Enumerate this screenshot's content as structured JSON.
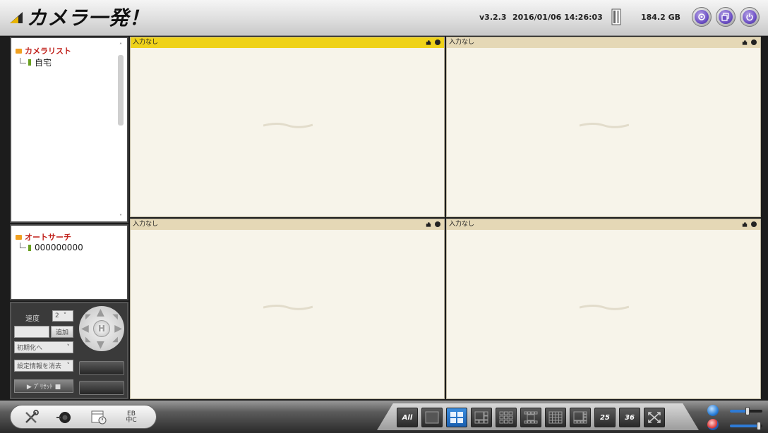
{
  "app": {
    "logo_text": "カメラ一発！"
  },
  "header": {
    "version": "v3.2.3",
    "datetime": "2016/01/06 14:26:03",
    "storage": "184.2 GB",
    "buttons": [
      {
        "icon": "settings-circle-icon"
      },
      {
        "icon": "restore-window-icon"
      },
      {
        "icon": "power-icon"
      }
    ]
  },
  "camera_list": {
    "title": "カメラリスト",
    "items": [
      {
        "label": "自宅"
      }
    ]
  },
  "auto_search": {
    "title": "オートサーチ",
    "items": [
      {
        "label": "000000000"
      }
    ]
  },
  "controls": {
    "speed_label": "速度",
    "speed_value": "2",
    "add_button": "追加",
    "preset_select": "初期化へ",
    "settings_select": "設定情報を消去",
    "bottom_button": "▶ ﾌﾟﾘｾｯﾄ ■"
  },
  "tiles": [
    {
      "label": "入力なし",
      "active": true
    },
    {
      "label": "入力なし",
      "active": false
    },
    {
      "label": "入力なし",
      "active": false
    },
    {
      "label": "入力なし",
      "active": false
    }
  ],
  "bottom_tools": [
    {
      "icon": "tools-icon"
    },
    {
      "icon": "camera-icon"
    },
    {
      "icon": "schedule-icon"
    },
    {
      "icon": "language-icon",
      "text": "EB 中C"
    }
  ],
  "layouts": [
    {
      "label": "All",
      "selected": false
    },
    {
      "label": "1",
      "selected": false
    },
    {
      "label": "4",
      "selected": true
    },
    {
      "label": "6",
      "selected": false
    },
    {
      "label": "9",
      "selected": false
    },
    {
      "label": "13",
      "selected": false
    },
    {
      "label": "16",
      "selected": false
    },
    {
      "label": "8",
      "selected": false
    },
    {
      "label": "25",
      "selected": false
    },
    {
      "label": "36",
      "selected": false
    },
    {
      "label": "fullscreen",
      "selected": false
    }
  ],
  "audio": {
    "speaker_level": 0.55,
    "mic_level": 0.9
  }
}
